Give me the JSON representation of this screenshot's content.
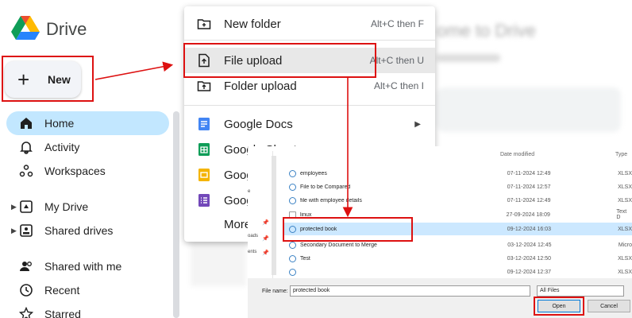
{
  "app": {
    "title": "Drive"
  },
  "sidebar": {
    "new_label": "New",
    "items": [
      {
        "label": "Home",
        "icon": "home-icon"
      },
      {
        "label": "Activity",
        "icon": "bell-icon"
      },
      {
        "label": "Workspaces",
        "icon": "workspaces-icon"
      },
      {
        "label": "My Drive",
        "icon": "my-drive-icon"
      },
      {
        "label": "Shared drives",
        "icon": "shared-drives-icon"
      },
      {
        "label": "Shared with me",
        "icon": "people-icon"
      },
      {
        "label": "Recent",
        "icon": "clock-icon"
      },
      {
        "label": "Starred",
        "icon": "star-icon"
      }
    ]
  },
  "main": {
    "welcome": "ome to Drive"
  },
  "new_menu": {
    "items": [
      {
        "label": "New folder",
        "shortcut": "Alt+C then F"
      },
      {
        "label": "File upload",
        "shortcut": "Alt+C then U"
      },
      {
        "label": "Folder upload",
        "shortcut": "Alt+C then I"
      },
      {
        "label": "Google Docs"
      },
      {
        "label": "Google Sheets"
      },
      {
        "label": "Goog"
      },
      {
        "label": "Goog"
      },
      {
        "label": "More"
      }
    ]
  },
  "file_dialog": {
    "headers": {
      "date": "Date modified",
      "type": "Type"
    },
    "left_labels": [
      "e",
      "oads",
      "ents"
    ],
    "files": [
      {
        "name": "employees",
        "date": "07-11-2024 12:49",
        "type": "XLSX"
      },
      {
        "name": "File to be Compared",
        "date": "07-11-2024 12:57",
        "type": "XLSX"
      },
      {
        "name": "file with employee details",
        "date": "07-11-2024 12:49",
        "type": "XLSX"
      },
      {
        "name": "linux",
        "date": "27-09-2024 18:09",
        "type": "Text D"
      },
      {
        "name": "protected book",
        "date": "09-12-2024 16:03",
        "type": "XLSX"
      },
      {
        "name": "Secondary Document to Merge",
        "date": "03-12-2024 12:45",
        "type": "Micro"
      },
      {
        "name": "Test",
        "date": "03-12-2024 12:50",
        "type": "XLSX"
      },
      {
        "name": "",
        "date": "09-12-2024 12:37",
        "type": "XLSX"
      }
    ],
    "file_name_label": "File name:",
    "file_name_value": "protected book",
    "file_type": "All Files",
    "open_label": "Open",
    "cancel_label": "Cancel"
  },
  "colors": {
    "accent": "#c2e7ff",
    "annotation": "#d11111",
    "selection": "#cce8ff"
  }
}
